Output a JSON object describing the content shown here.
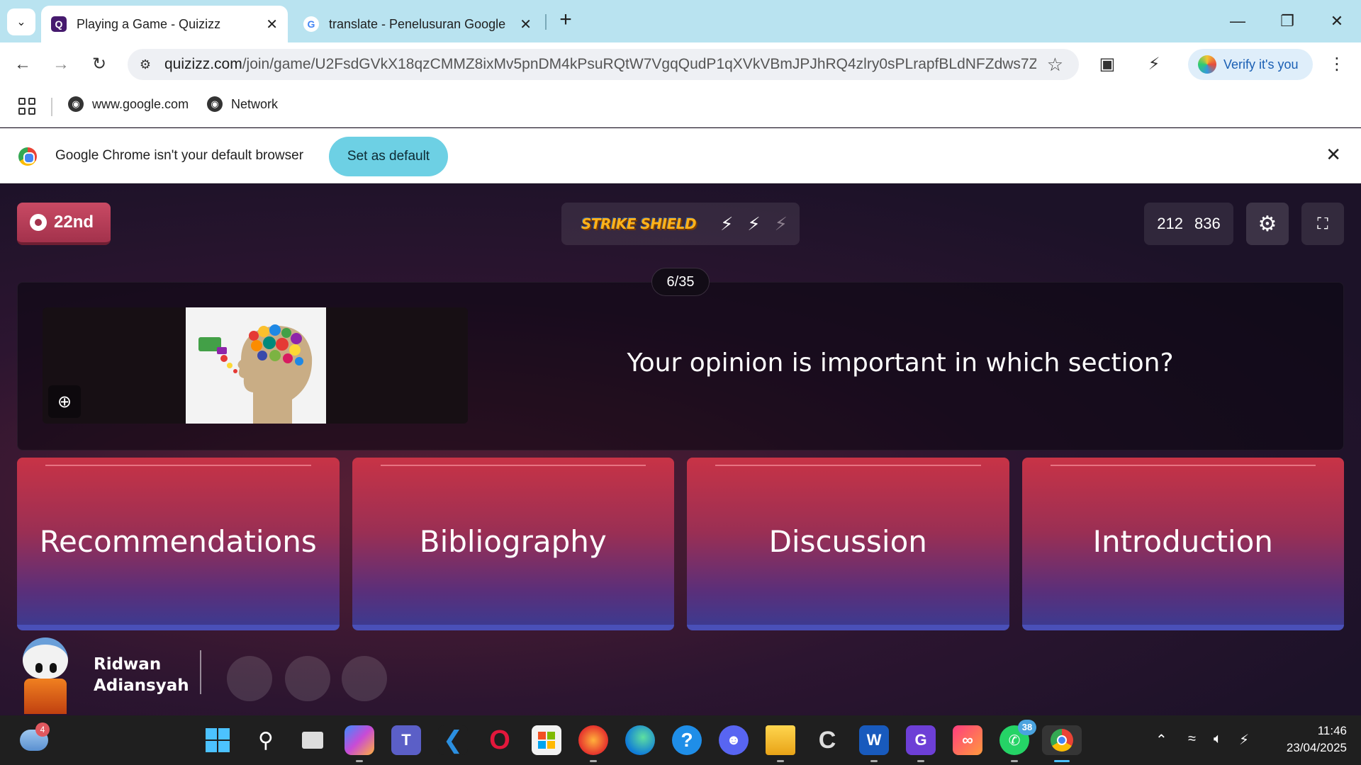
{
  "browser": {
    "tabs": [
      {
        "title": "Playing a Game - Quizizz",
        "favicon": "Q"
      },
      {
        "title": "translate - Penelusuran Google",
        "favicon": "G"
      }
    ],
    "url_host": "quizizz.com",
    "url_path": "/join/game/U2FsdGVkX18qzCMMZ8ixMv5pnDM4kPsuRQtW7VgqQudP1qXVkVBmJPJhRQ4zlry0sPLrapfBLdNFZdws7ZT...",
    "profile_label": "Verify it's you",
    "bookmarks": [
      "www.google.com",
      "Network"
    ],
    "infobar": {
      "message": "Google Chrome isn't your default browser",
      "button": "Set as default"
    }
  },
  "game": {
    "rank": "22nd",
    "powerup_logo": "STRIKE SHIELD",
    "powerup_charges": {
      "filled": 2,
      "total": 3
    },
    "score_parts": [
      "212",
      "836"
    ],
    "question_counter": "6/35",
    "question_text": "Your opinion is important in which section?",
    "answers": [
      "Recommendations",
      "Bibliography",
      "Discussion",
      "Introduction"
    ],
    "player_name_line1": "Ridwan",
    "player_name_line2": "Adiansyah"
  },
  "taskbar": {
    "weather_badge": "4",
    "whatsapp_badge": "38",
    "time": "11:46",
    "date": "23/04/2025"
  },
  "colors": {
    "answer_top": "#c83346",
    "answer_bottom": "#3e3a8f",
    "infobar_button": "#6dd0e4",
    "tab_strip": "#b9e3f0"
  }
}
